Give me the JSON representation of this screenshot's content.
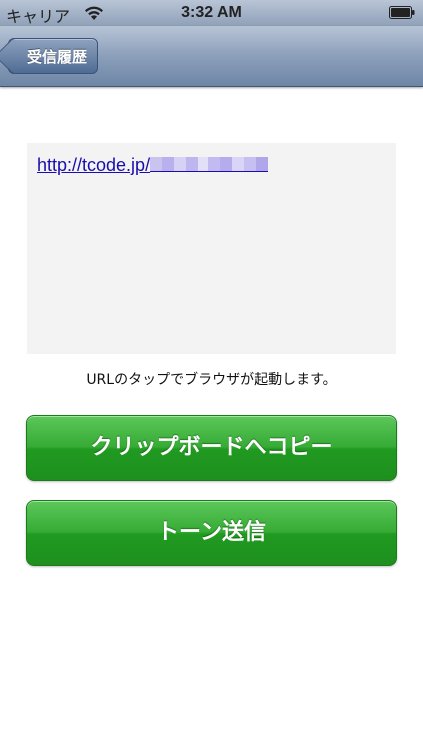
{
  "status_bar": {
    "carrier": "キャリア",
    "time": "3:32 AM",
    "icons": [
      "wifi-icon",
      "battery-icon"
    ]
  },
  "nav_bar": {
    "back_label": "受信履歴",
    "color": "#6e86a6"
  },
  "content": {
    "url_text": "http://tcode.jp/",
    "url_redacted": true,
    "hint": "URLのタップでブラウザが起動します。"
  },
  "buttons": {
    "copy_label": "クリップボードへコピー",
    "tone_label": "トーン送信",
    "color": "#2aa12a"
  }
}
